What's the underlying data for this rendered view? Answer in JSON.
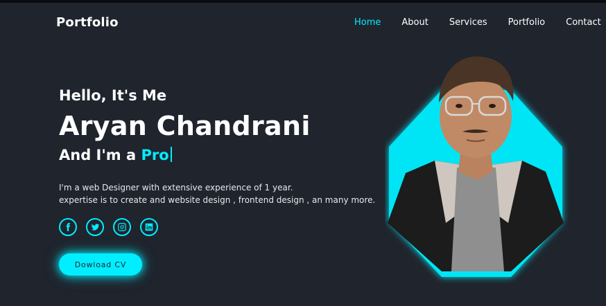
{
  "header": {
    "logo": "Portfolio",
    "nav": [
      {
        "label": "Home",
        "active": true
      },
      {
        "label": "About",
        "active": false
      },
      {
        "label": "Services",
        "active": false
      },
      {
        "label": "Portfolio",
        "active": false
      },
      {
        "label": "Contact",
        "active": false
      }
    ]
  },
  "hero": {
    "greeting": "Hello, It's Me",
    "name": "Aryan Chandrani",
    "role_prefix": "And I'm a",
    "role_typed": "Pro",
    "description_line1": "I'm a web Designer with extensive experience of 1 year.",
    "description_line2": "expertise is to create and website design , frontend design , an many more.",
    "cv_button": "Dowload CV"
  },
  "socials": [
    {
      "icon": "facebook-icon"
    },
    {
      "icon": "twitter-icon"
    },
    {
      "icon": "instagram-icon"
    },
    {
      "icon": "linkedin-icon"
    }
  ],
  "colors": {
    "background": "#1f242d",
    "accent": "#00eeff",
    "text": "#ffffff"
  }
}
